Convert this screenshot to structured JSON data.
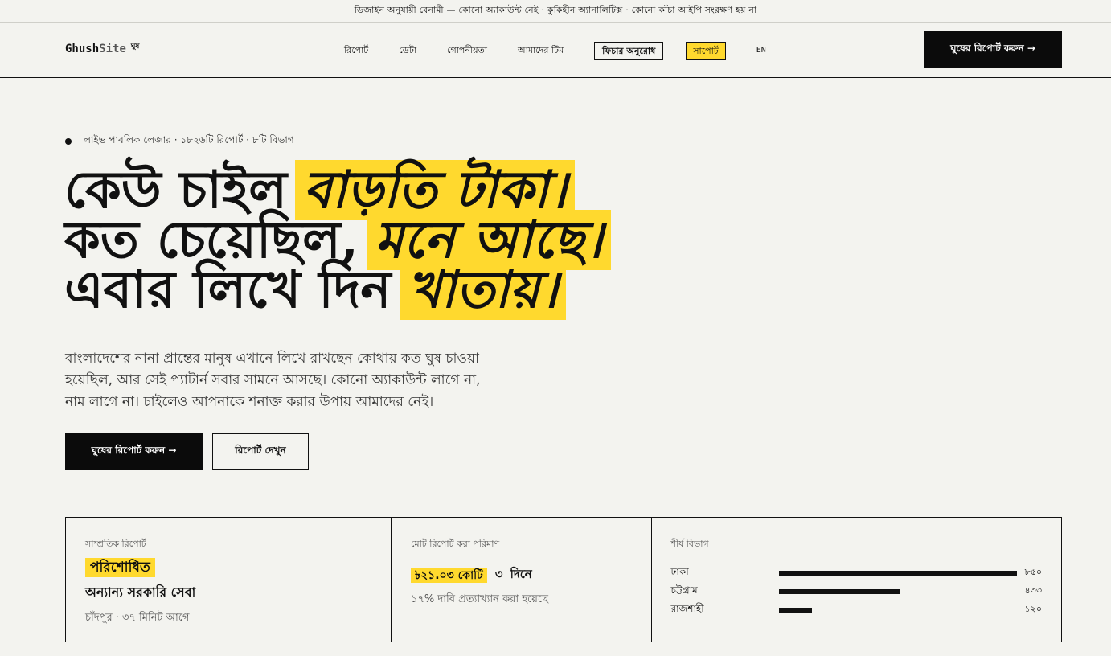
{
  "announcement": "ডিজাইন অনুযায়ী বেনামী — কোনো অ্যাকাউন্ট নেই · কুকিহীন অ্যানালিটিক্স · কোনো কাঁচা আইপি সংরক্ষণ হয় না",
  "nav": {
    "logo_main": "Ghush",
    "logo_accent": "Site",
    "logo_mark": "ঘুষ",
    "links": {
      "reports": "রিপোর্ট",
      "data": "ডেটা",
      "privacy": "গোপনীয়তা",
      "team": "আমাদের টিম",
      "feature_request": "ফিচার অনুরোধ",
      "support": "সাপোর্ট",
      "language": "EN"
    },
    "cta": "ঘুষের রিপোর্ট করুন →"
  },
  "hero": {
    "ledger": "লাইভ পাবলিক লেজার · ১৮২৬টি রিপোর্ট · ৮টি বিভাগ",
    "line1_plain": "কেউ চাইল",
    "line1_mark": "বাড়তি টাকা।",
    "line2_plain": "কত চেয়েছিল,",
    "line2_mark": "মনে আছে।",
    "line3_plain": "এবার লিখে দিন",
    "line3_mark": "খাতায়।",
    "intro": "বাংলাদেশের নানা প্রান্তের মানুষ এখানে লিখে রাখছেন কোথায় কত ঘুষ চাওয়া হয়েছিল, আর সেই প্যাটার্ন সবার সামনে আসছে। কোনো অ্যাকাউন্ট লাগে না, নাম লাগে না। চাইলেও আপনাকে শনাক্ত করার উপায় আমাদের নেই।",
    "primary_button": "ঘুষের রিপোর্ট করুন →",
    "secondary_button": "রিপোর্ট দেখুন"
  },
  "stats": {
    "recent": {
      "label": "সাম্প্রতিক রিপোর্ট",
      "status": "পরিশোধিত",
      "title": "অন্যান্য সরকারি সেবা",
      "meta": "চাঁদপুর · ৩৭ মিনিট আগে"
    },
    "total": {
      "label": "মোট রিপোর্ট করা পরিমাণ",
      "amount": "৳২১.০৩ কোটি",
      "period": "৩ দিনে",
      "rejected": "১৭% দাবি প্রত্যাখ্যান করা হয়েছে"
    },
    "departments": {
      "label": "শীর্ষ বিভাগ",
      "items": [
        {
          "name": "ঢাকা",
          "count": "৮৫০",
          "value": 850
        },
        {
          "name": "চট্টগ্রাম",
          "count": "৪৩৩",
          "value": 433
        },
        {
          "name": "রাজশাহী",
          "count": "১২০",
          "value": 120
        }
      ]
    }
  }
}
